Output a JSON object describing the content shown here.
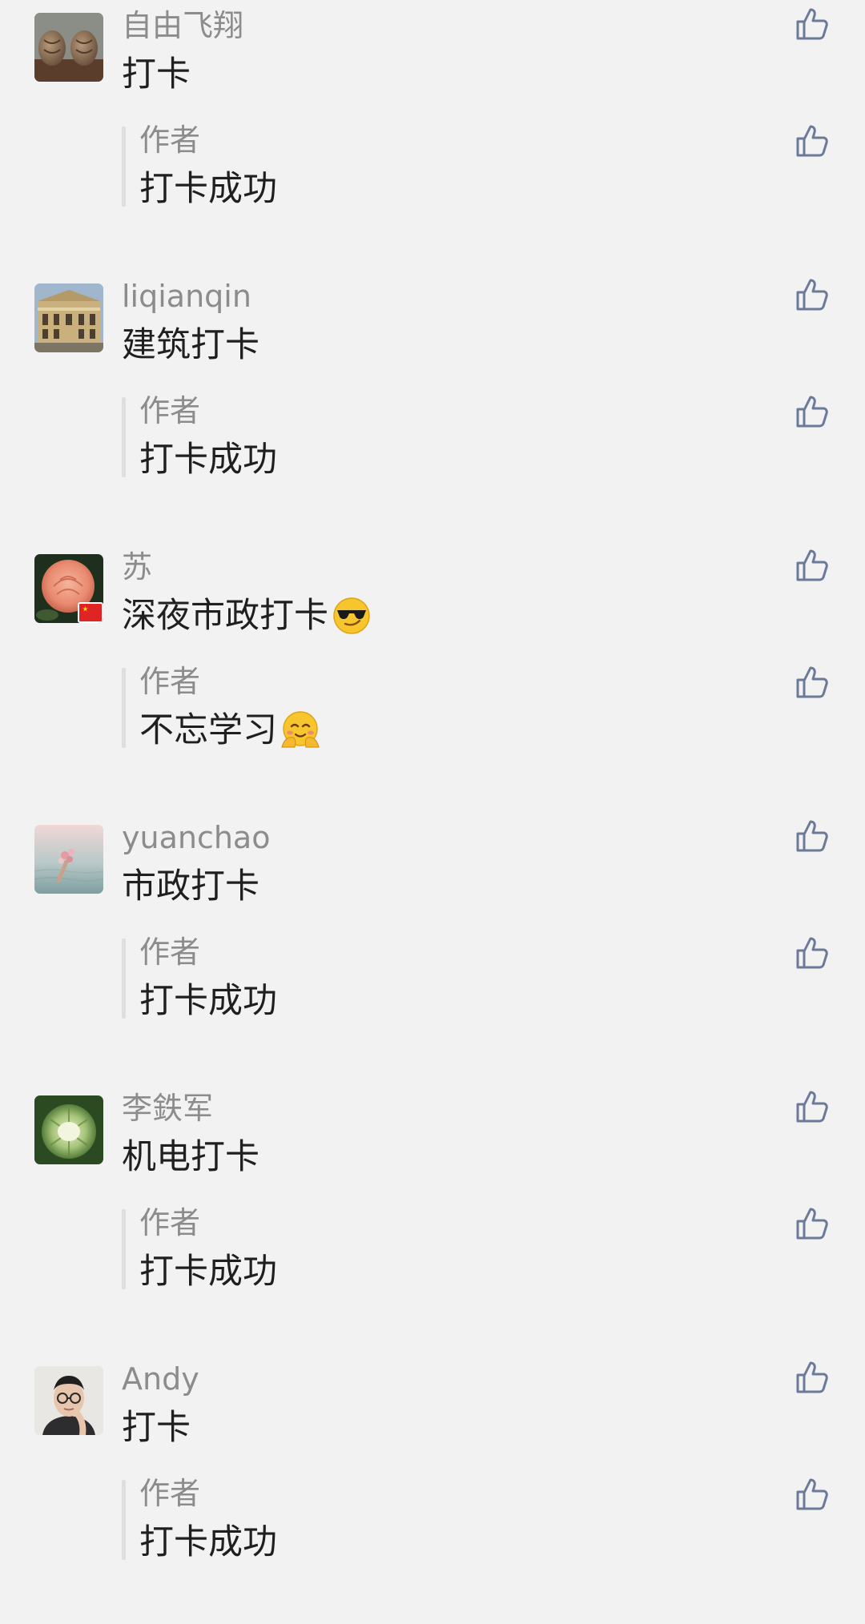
{
  "comments": [
    {
      "username": "自由飞翔",
      "text": "打卡",
      "avatar_icon": "walnuts-photo-avatar",
      "reply": {
        "author": "作者",
        "text": "打卡成功"
      }
    },
    {
      "username": "liqianqin",
      "text": "建筑打卡",
      "avatar_icon": "building-photo-avatar",
      "reply": {
        "author": "作者",
        "text": "打卡成功"
      }
    },
    {
      "username": "苏",
      "text": "深夜市政打卡",
      "text_emoji": "sunglasses-smile-emoji",
      "avatar_icon": "peach-rose-photo-avatar",
      "avatar_badge": "china-flag-icon",
      "reply": {
        "author": "作者",
        "text": "不忘学习",
        "text_emoji": "hugging-face-emoji"
      }
    },
    {
      "username": "yuanchao",
      "text": "市政打卡",
      "avatar_icon": "flowers-over-water-photo-avatar",
      "reply": {
        "author": "作者",
        "text": "打卡成功"
      }
    },
    {
      "username": "李鉄军",
      "text": "机电打卡",
      "avatar_icon": "cabbage-photo-avatar",
      "reply": {
        "author": "作者",
        "text": "打卡成功"
      }
    },
    {
      "username": "Andy",
      "text": "打卡",
      "avatar_icon": "man-with-glasses-photo-avatar",
      "reply": {
        "author": "作者",
        "text": "打卡成功"
      }
    }
  ],
  "colors": {
    "background": "#f2f2f2",
    "username": "#8c8c8c",
    "text": "#1f1f1f",
    "like_icon": "#6b7a99",
    "reply_bar": "#dedede"
  },
  "icons": {
    "like": "thumbs-up-outline-icon"
  }
}
